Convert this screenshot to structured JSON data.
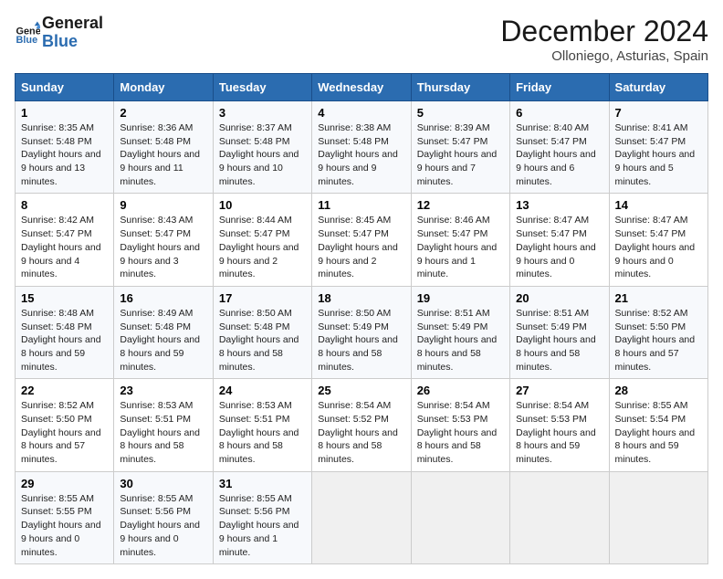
{
  "header": {
    "logo_text_general": "General",
    "logo_text_blue": "Blue",
    "month": "December 2024",
    "location": "Olloniego, Asturias, Spain"
  },
  "weekdays": [
    "Sunday",
    "Monday",
    "Tuesday",
    "Wednesday",
    "Thursday",
    "Friday",
    "Saturday"
  ],
  "weeks": [
    [
      {
        "day": 1,
        "sunrise": "8:35 AM",
        "sunset": "5:48 PM",
        "daylight": "9 hours and 13 minutes."
      },
      {
        "day": 2,
        "sunrise": "8:36 AM",
        "sunset": "5:48 PM",
        "daylight": "9 hours and 11 minutes."
      },
      {
        "day": 3,
        "sunrise": "8:37 AM",
        "sunset": "5:48 PM",
        "daylight": "9 hours and 10 minutes."
      },
      {
        "day": 4,
        "sunrise": "8:38 AM",
        "sunset": "5:48 PM",
        "daylight": "9 hours and 9 minutes."
      },
      {
        "day": 5,
        "sunrise": "8:39 AM",
        "sunset": "5:47 PM",
        "daylight": "9 hours and 7 minutes."
      },
      {
        "day": 6,
        "sunrise": "8:40 AM",
        "sunset": "5:47 PM",
        "daylight": "9 hours and 6 minutes."
      },
      {
        "day": 7,
        "sunrise": "8:41 AM",
        "sunset": "5:47 PM",
        "daylight": "9 hours and 5 minutes."
      }
    ],
    [
      {
        "day": 8,
        "sunrise": "8:42 AM",
        "sunset": "5:47 PM",
        "daylight": "9 hours and 4 minutes."
      },
      {
        "day": 9,
        "sunrise": "8:43 AM",
        "sunset": "5:47 PM",
        "daylight": "9 hours and 3 minutes."
      },
      {
        "day": 10,
        "sunrise": "8:44 AM",
        "sunset": "5:47 PM",
        "daylight": "9 hours and 2 minutes."
      },
      {
        "day": 11,
        "sunrise": "8:45 AM",
        "sunset": "5:47 PM",
        "daylight": "9 hours and 2 minutes."
      },
      {
        "day": 12,
        "sunrise": "8:46 AM",
        "sunset": "5:47 PM",
        "daylight": "9 hours and 1 minute."
      },
      {
        "day": 13,
        "sunrise": "8:47 AM",
        "sunset": "5:47 PM",
        "daylight": "9 hours and 0 minutes."
      },
      {
        "day": 14,
        "sunrise": "8:47 AM",
        "sunset": "5:47 PM",
        "daylight": "9 hours and 0 minutes."
      }
    ],
    [
      {
        "day": 15,
        "sunrise": "8:48 AM",
        "sunset": "5:48 PM",
        "daylight": "8 hours and 59 minutes."
      },
      {
        "day": 16,
        "sunrise": "8:49 AM",
        "sunset": "5:48 PM",
        "daylight": "8 hours and 59 minutes."
      },
      {
        "day": 17,
        "sunrise": "8:50 AM",
        "sunset": "5:48 PM",
        "daylight": "8 hours and 58 minutes."
      },
      {
        "day": 18,
        "sunrise": "8:50 AM",
        "sunset": "5:49 PM",
        "daylight": "8 hours and 58 minutes."
      },
      {
        "day": 19,
        "sunrise": "8:51 AM",
        "sunset": "5:49 PM",
        "daylight": "8 hours and 58 minutes."
      },
      {
        "day": 20,
        "sunrise": "8:51 AM",
        "sunset": "5:49 PM",
        "daylight": "8 hours and 58 minutes."
      },
      {
        "day": 21,
        "sunrise": "8:52 AM",
        "sunset": "5:50 PM",
        "daylight": "8 hours and 57 minutes."
      }
    ],
    [
      {
        "day": 22,
        "sunrise": "8:52 AM",
        "sunset": "5:50 PM",
        "daylight": "8 hours and 57 minutes."
      },
      {
        "day": 23,
        "sunrise": "8:53 AM",
        "sunset": "5:51 PM",
        "daylight": "8 hours and 58 minutes."
      },
      {
        "day": 24,
        "sunrise": "8:53 AM",
        "sunset": "5:51 PM",
        "daylight": "8 hours and 58 minutes."
      },
      {
        "day": 25,
        "sunrise": "8:54 AM",
        "sunset": "5:52 PM",
        "daylight": "8 hours and 58 minutes."
      },
      {
        "day": 26,
        "sunrise": "8:54 AM",
        "sunset": "5:53 PM",
        "daylight": "8 hours and 58 minutes."
      },
      {
        "day": 27,
        "sunrise": "8:54 AM",
        "sunset": "5:53 PM",
        "daylight": "8 hours and 59 minutes."
      },
      {
        "day": 28,
        "sunrise": "8:55 AM",
        "sunset": "5:54 PM",
        "daylight": "8 hours and 59 minutes."
      }
    ],
    [
      {
        "day": 29,
        "sunrise": "8:55 AM",
        "sunset": "5:55 PM",
        "daylight": "9 hours and 0 minutes."
      },
      {
        "day": 30,
        "sunrise": "8:55 AM",
        "sunset": "5:56 PM",
        "daylight": "9 hours and 0 minutes."
      },
      {
        "day": 31,
        "sunrise": "8:55 AM",
        "sunset": "5:56 PM",
        "daylight": "9 hours and 1 minute."
      },
      null,
      null,
      null,
      null
    ]
  ]
}
